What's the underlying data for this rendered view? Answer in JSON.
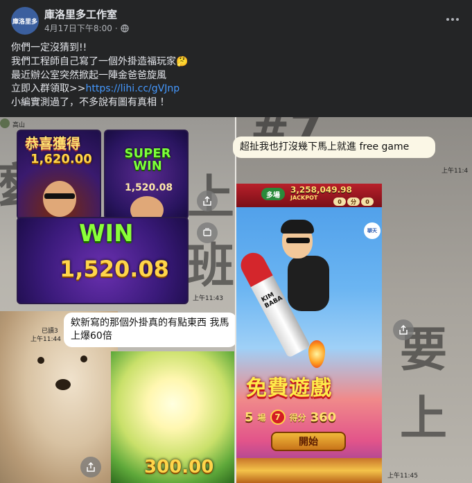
{
  "header": {
    "avatar_text": "庫洛里多",
    "page_name": "庫洛里多工作室",
    "timestamp": "4月17日下午8:00",
    "separator": "·",
    "privacy_icon": "globe-icon",
    "more_icon": "more-horizontal-icon"
  },
  "post": {
    "lines": [
      "你們一定沒猜到!!",
      "我們工程師自己寫了一個外掛造福玩家🤔",
      "最近辦公室突然掀起一陣金爸爸旋風",
      "小編實測過了，不多說有圖有真相 ！"
    ],
    "link_prefix": "立即入群領取>>",
    "link_text": "https://lihi.cc/gVJnp"
  },
  "photo": {
    "left": {
      "sender": "高山",
      "bg_glyph_1": "麼",
      "bg_glyph_2": "上班",
      "card_gongxi_title": "恭喜獲得",
      "card_gongxi_amount": "1,620.00",
      "card_super_title": "SUPER WIN",
      "card_super_amount": "1,520.08",
      "card_win_title": "WIN",
      "card_win_amount": "1,520.08",
      "time_1": "上午11:43",
      "read_label": "已讀3",
      "time_2": "上午11:44",
      "bubble_text": "欸新寫的那個外掛真的有點東西 我馬上爆60倍",
      "confetti_amount": "300.00",
      "share_icon": "share-icon",
      "stack_icon": "stack-icon"
    },
    "right": {
      "bg_glyph_1": "#7",
      "bg_glyph_2": "要上",
      "bubble_text": "超扯我也打沒幾下馬上就進 free game",
      "time_1": "上午11:4",
      "game_jackpot_amount": "3,258,049.98",
      "game_jackpot_label": "JACKPOT",
      "game_pill": "多場",
      "game_score_1": "0",
      "game_score_2": "分",
      "game_score_3": "0",
      "game_chat_label": "聊天",
      "rocket_label": "KIM BABA",
      "free_game_title": "免費遊戲",
      "rounds_value": "5",
      "rounds_unit": "場",
      "score_label": "得分",
      "score_value": "360",
      "start_button": "開始",
      "time_2": "上午11:45"
    }
  }
}
